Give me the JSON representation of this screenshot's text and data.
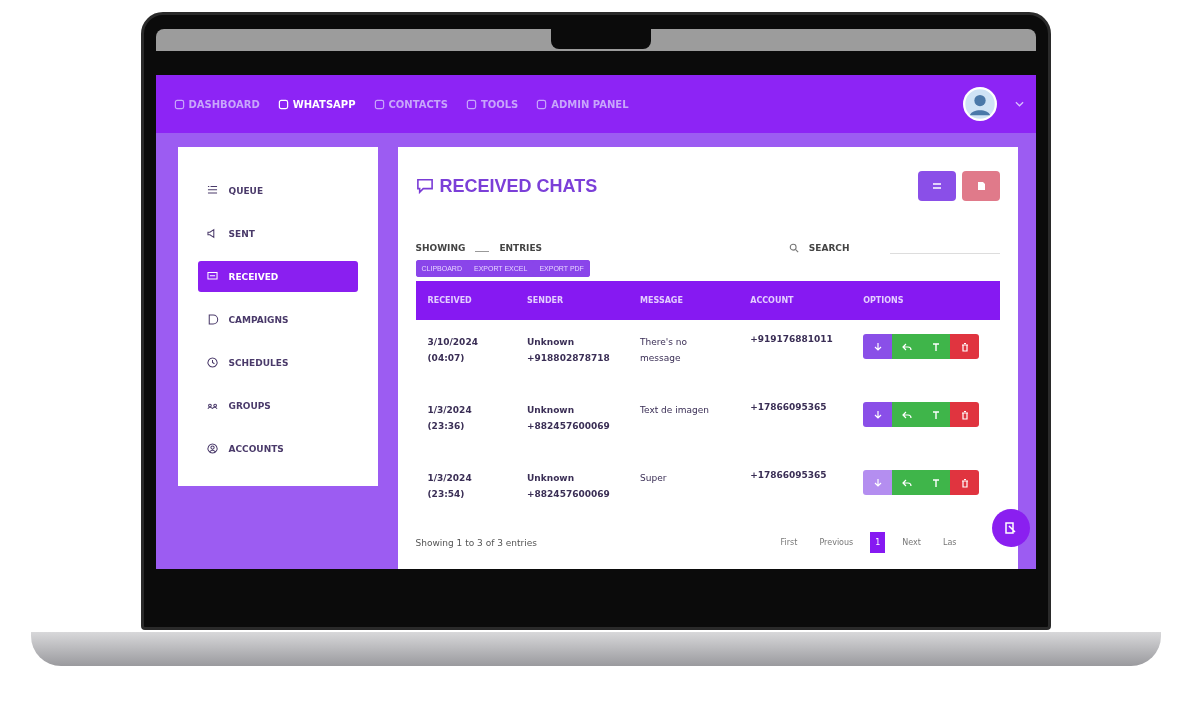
{
  "nav": {
    "items": [
      {
        "label": "DASHBOARD",
        "selected": false
      },
      {
        "label": "WHATSAPP",
        "selected": true
      },
      {
        "label": "CONTACTS",
        "selected": false
      },
      {
        "label": "TOOLS",
        "selected": false
      },
      {
        "label": "ADMIN PANEL",
        "selected": false
      }
    ]
  },
  "sidebar": {
    "items": [
      {
        "label": "QUEUE",
        "selected": false
      },
      {
        "label": "SENT",
        "selected": false
      },
      {
        "label": "RECEIVED",
        "selected": true
      },
      {
        "label": "CAMPAIGNS",
        "selected": false
      },
      {
        "label": "SCHEDULES",
        "selected": false
      },
      {
        "label": "GROUPS",
        "selected": false
      },
      {
        "label": "ACCOUNTS",
        "selected": false
      }
    ]
  },
  "main": {
    "title": "RECEIVED CHATS",
    "length_label_before": "SHOWING",
    "length_label_after": "ENTRIES",
    "search_label": "SEARCH",
    "export_buttons": [
      "CLIPBOARD",
      "EXPORT EXCEL",
      "EXPORT PDF"
    ],
    "table": {
      "columns": [
        "RECEIVED",
        "SENDER",
        "MESSAGE",
        "ACCOUNT",
        "OPTIONS"
      ],
      "rows": [
        {
          "received": "3/10/2024 (04:07)",
          "sender_name": "Unknown",
          "sender_number": "+918802878718",
          "message": "There's no message",
          "account": "+919176881011",
          "download_disabled": false
        },
        {
          "received": "1/3/2024 (23:36)",
          "sender_name": "Unknown",
          "sender_number": "+882457600069",
          "message": "Text de imagen",
          "account": "+17866095365",
          "download_disabled": false
        },
        {
          "received": "1/3/2024 (23:54)",
          "sender_name": "Unknown",
          "sender_number": "+882457600069",
          "message": "Super",
          "account": "+17866095365",
          "download_disabled": true
        }
      ]
    },
    "info": "Showing 1 to 3 of 3 entries",
    "pagination": [
      {
        "label": "First",
        "selected": false
      },
      {
        "label": "Previous",
        "selected": false
      },
      {
        "label": "1",
        "selected": true
      },
      {
        "label": "Next",
        "selected": false
      },
      {
        "label": "Las",
        "selected": false
      }
    ]
  }
}
